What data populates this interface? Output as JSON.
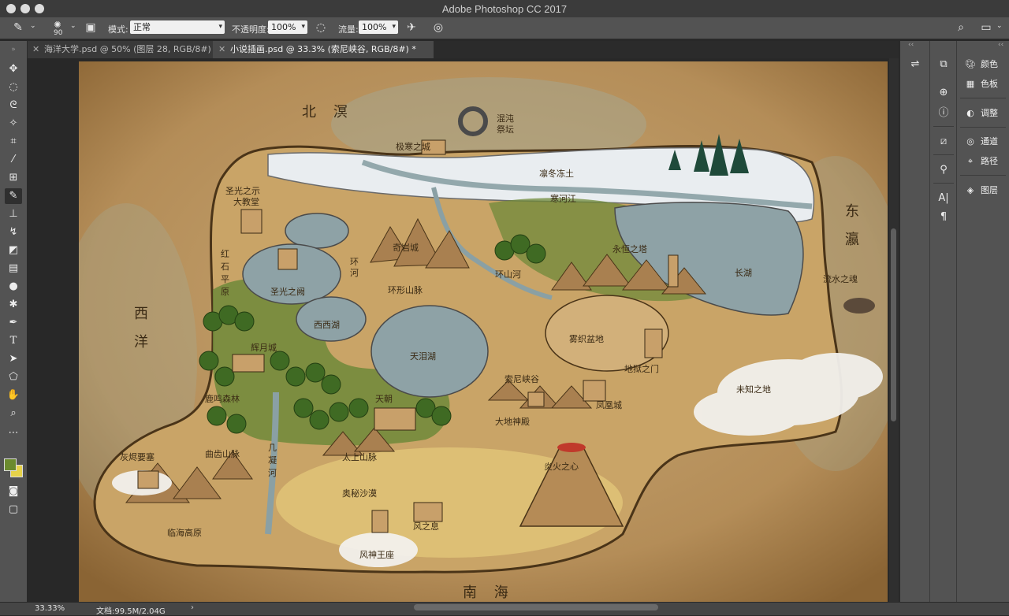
{
  "window": {
    "title": "Adobe Photoshop CC 2017"
  },
  "options_bar": {
    "brush_size": "90",
    "mode_label": "模式:",
    "mode_value": "正常",
    "opacity_label": "不透明度:",
    "opacity_value": "100%",
    "flow_label": "流量:",
    "flow_value": "100%"
  },
  "tabs": [
    {
      "label": "海洋大学.psd @ 50% (图层 28, RGB/8#)",
      "active": false
    },
    {
      "label": "小说插画.psd @ 33.3% (索尼峡谷, RGB/8#) *",
      "active": true
    }
  ],
  "tools": [
    "move-tool",
    "marquee-tool",
    "lasso-tool",
    "quick-select-tool",
    "crop-tool",
    "eyedropper-tool",
    "healing-tool",
    "brush-tool",
    "stamp-tool",
    "history-brush-tool",
    "eraser-tool",
    "gradient-tool",
    "blur-tool",
    "dodge-tool",
    "pen-tool",
    "type-tool",
    "path-select-tool",
    "shape-tool",
    "hand-tool",
    "zoom-tool",
    "more-tools"
  ],
  "colors": {
    "foreground": "#6b8a2e",
    "background": "#e6d24a",
    "accent": "#3a2a14"
  },
  "map_labels": {
    "north_sea": "北 溟",
    "east_sea": "东",
    "east_sea2": "瀛",
    "west_sea": "西",
    "west_sea2": "洋",
    "south_sea": "南 海",
    "chaos_altar": "混沌",
    "chaos_altar2": "祭坛",
    "ice_city": "极寒之城",
    "frost_land": "凛冬冻土",
    "cold_river": "寒河江",
    "cathedral": "圣光之示",
    "cathedral2": "大教堂",
    "red_plain_1": "红",
    "red_plain_2": "石",
    "red_plain_3": "平",
    "red_plain_4": "原",
    "odd_rock_city": "奇岩城",
    "ring_river": "环",
    "ring_river2": "河",
    "ring_mountains": "环形山脉",
    "holy_light": "圣光之阙",
    "eternal_tower": "永恒之塔",
    "long_lake": "长湖",
    "flowing_soul": "流水之魂",
    "ring_river_east": "环山河",
    "west_lake": "西西湖",
    "fog_basin": "雾织盆地",
    "hell_gate": "地狱之门",
    "tear_lake": "天泪湖",
    "moon_city": "辉月城",
    "sony_canyon": "索尼峡谷",
    "phoenix_city": "凤凰城",
    "unknown_land": "未知之地",
    "deer_forest": "鹿鸣森林",
    "dynasty": "天朝",
    "earth_temple": "大地神殿",
    "crystal_fort": "灰烬要塞",
    "qu_mountains": "曲齿山脉",
    "ji_river_1": "几",
    "ji_river_2": "凝",
    "ji_river_3": "河",
    "taishang": "太上山脉",
    "fire_heart": "炎火之心",
    "secret_desert": "奥秘沙漠",
    "wind_rest": "风之息",
    "sea_plateau": "临海高原",
    "wind_throne": "风神王座"
  },
  "right_panels": {
    "color": "颜色",
    "swatches": "色板",
    "adjustments": "调整",
    "channels": "通道",
    "paths": "路径",
    "layers": "图层"
  },
  "status": {
    "zoom": "33.33%",
    "doc": "文档:99.5M/2.04G"
  }
}
